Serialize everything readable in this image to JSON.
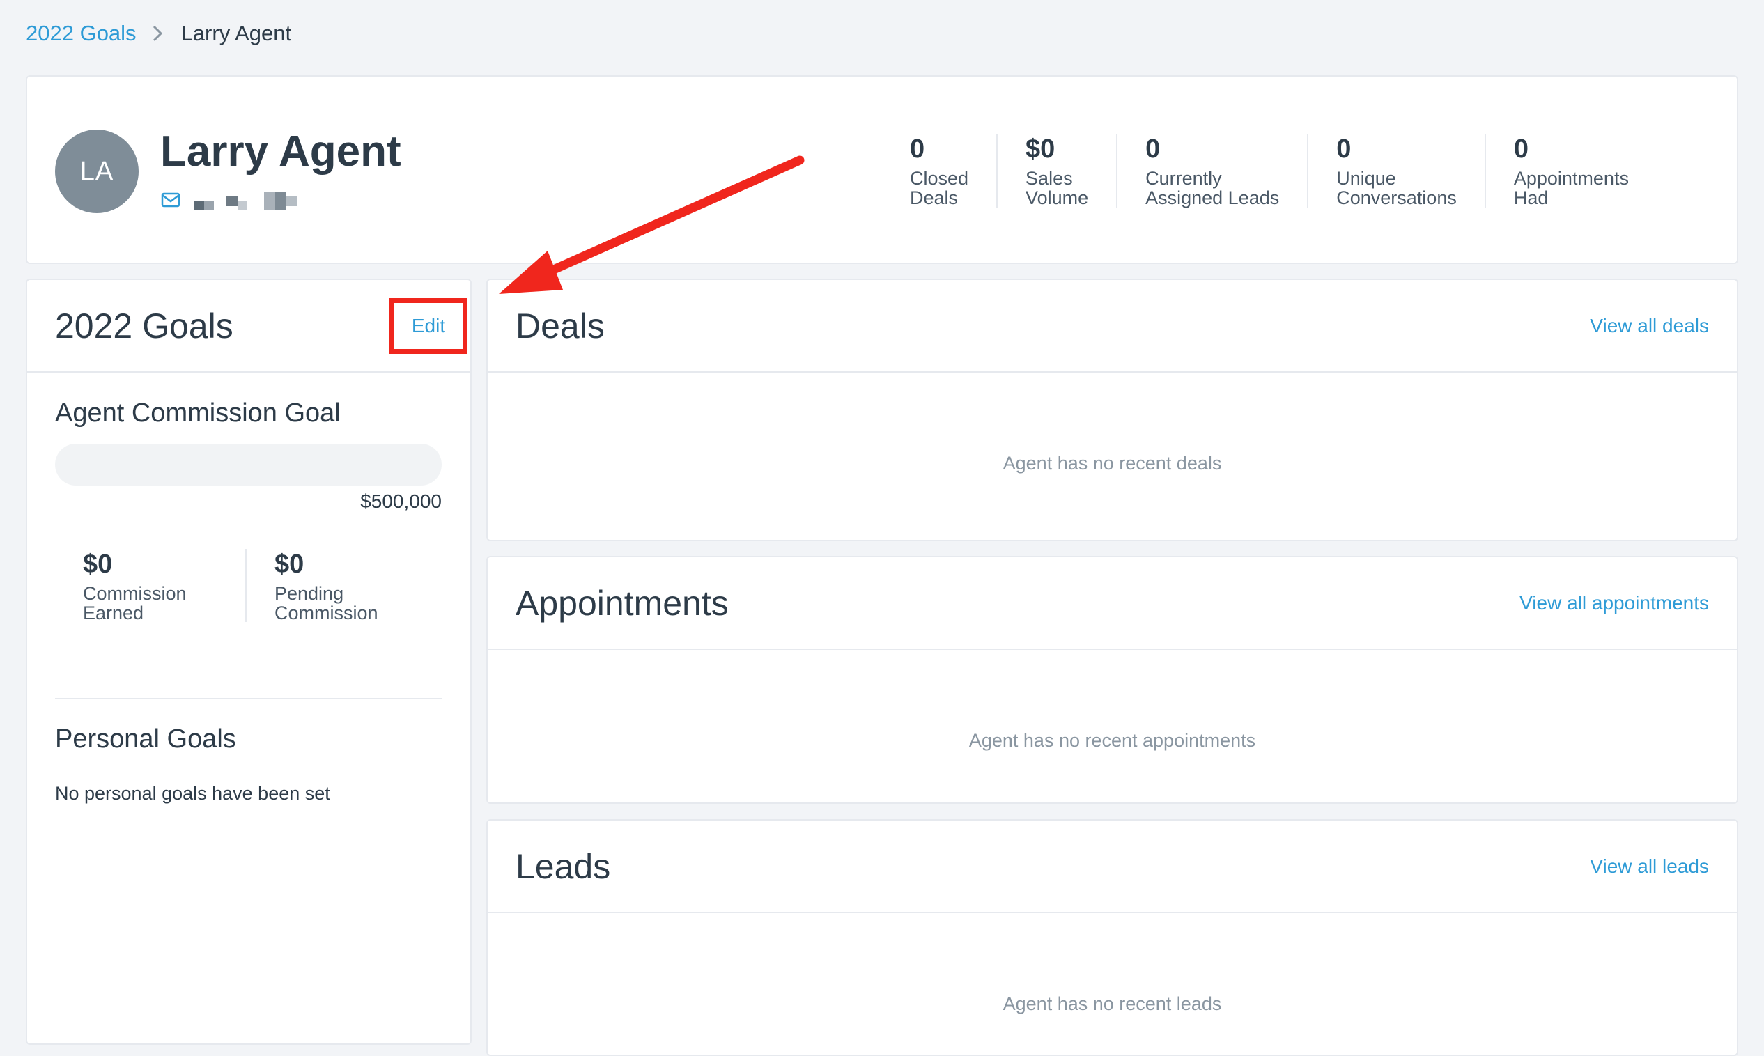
{
  "breadcrumb": {
    "parent": "2022 Goals",
    "current": "Larry Agent"
  },
  "profile": {
    "initials": "LA",
    "name": "Larry Agent",
    "stats": [
      {
        "value": "0",
        "label": "Closed\nDeals"
      },
      {
        "value": "$0",
        "label": "Sales\nVolume"
      },
      {
        "value": "0",
        "label": "Currently\nAssigned Leads"
      },
      {
        "value": "0",
        "label": "Unique\nConversations"
      },
      {
        "value": "0",
        "label": "Appointments\nHad"
      }
    ]
  },
  "goals": {
    "title": "2022 Goals",
    "edit_label": "Edit",
    "commission_goal_title": "Agent Commission Goal",
    "commission_goal_amount": "$500,000",
    "progress_fraction": 0,
    "commission_earned": {
      "value": "$0",
      "label": "Commission\nEarned"
    },
    "pending_commission": {
      "value": "$0",
      "label": "Pending\nCommission"
    },
    "personal_goals_title": "Personal Goals",
    "personal_goals_empty": "No personal goals have been set"
  },
  "deals": {
    "title": "Deals",
    "link": "View all deals",
    "empty": "Agent has no recent deals"
  },
  "appointments": {
    "title": "Appointments",
    "link": "View all appointments",
    "empty": "Agent has no recent appointments"
  },
  "leads": {
    "title": "Leads",
    "link": "View all leads",
    "empty": "Agent has no recent leads"
  },
  "colors": {
    "accent": "#2e9bd6",
    "annotation_red": "#f0261d",
    "avatar_bg": "#7f8d98",
    "page_bg": "#f2f4f7"
  },
  "icons": {
    "breadcrumb_separator": "chevron-right-icon",
    "email": "mail-icon",
    "annotation": "arrow-icon"
  }
}
